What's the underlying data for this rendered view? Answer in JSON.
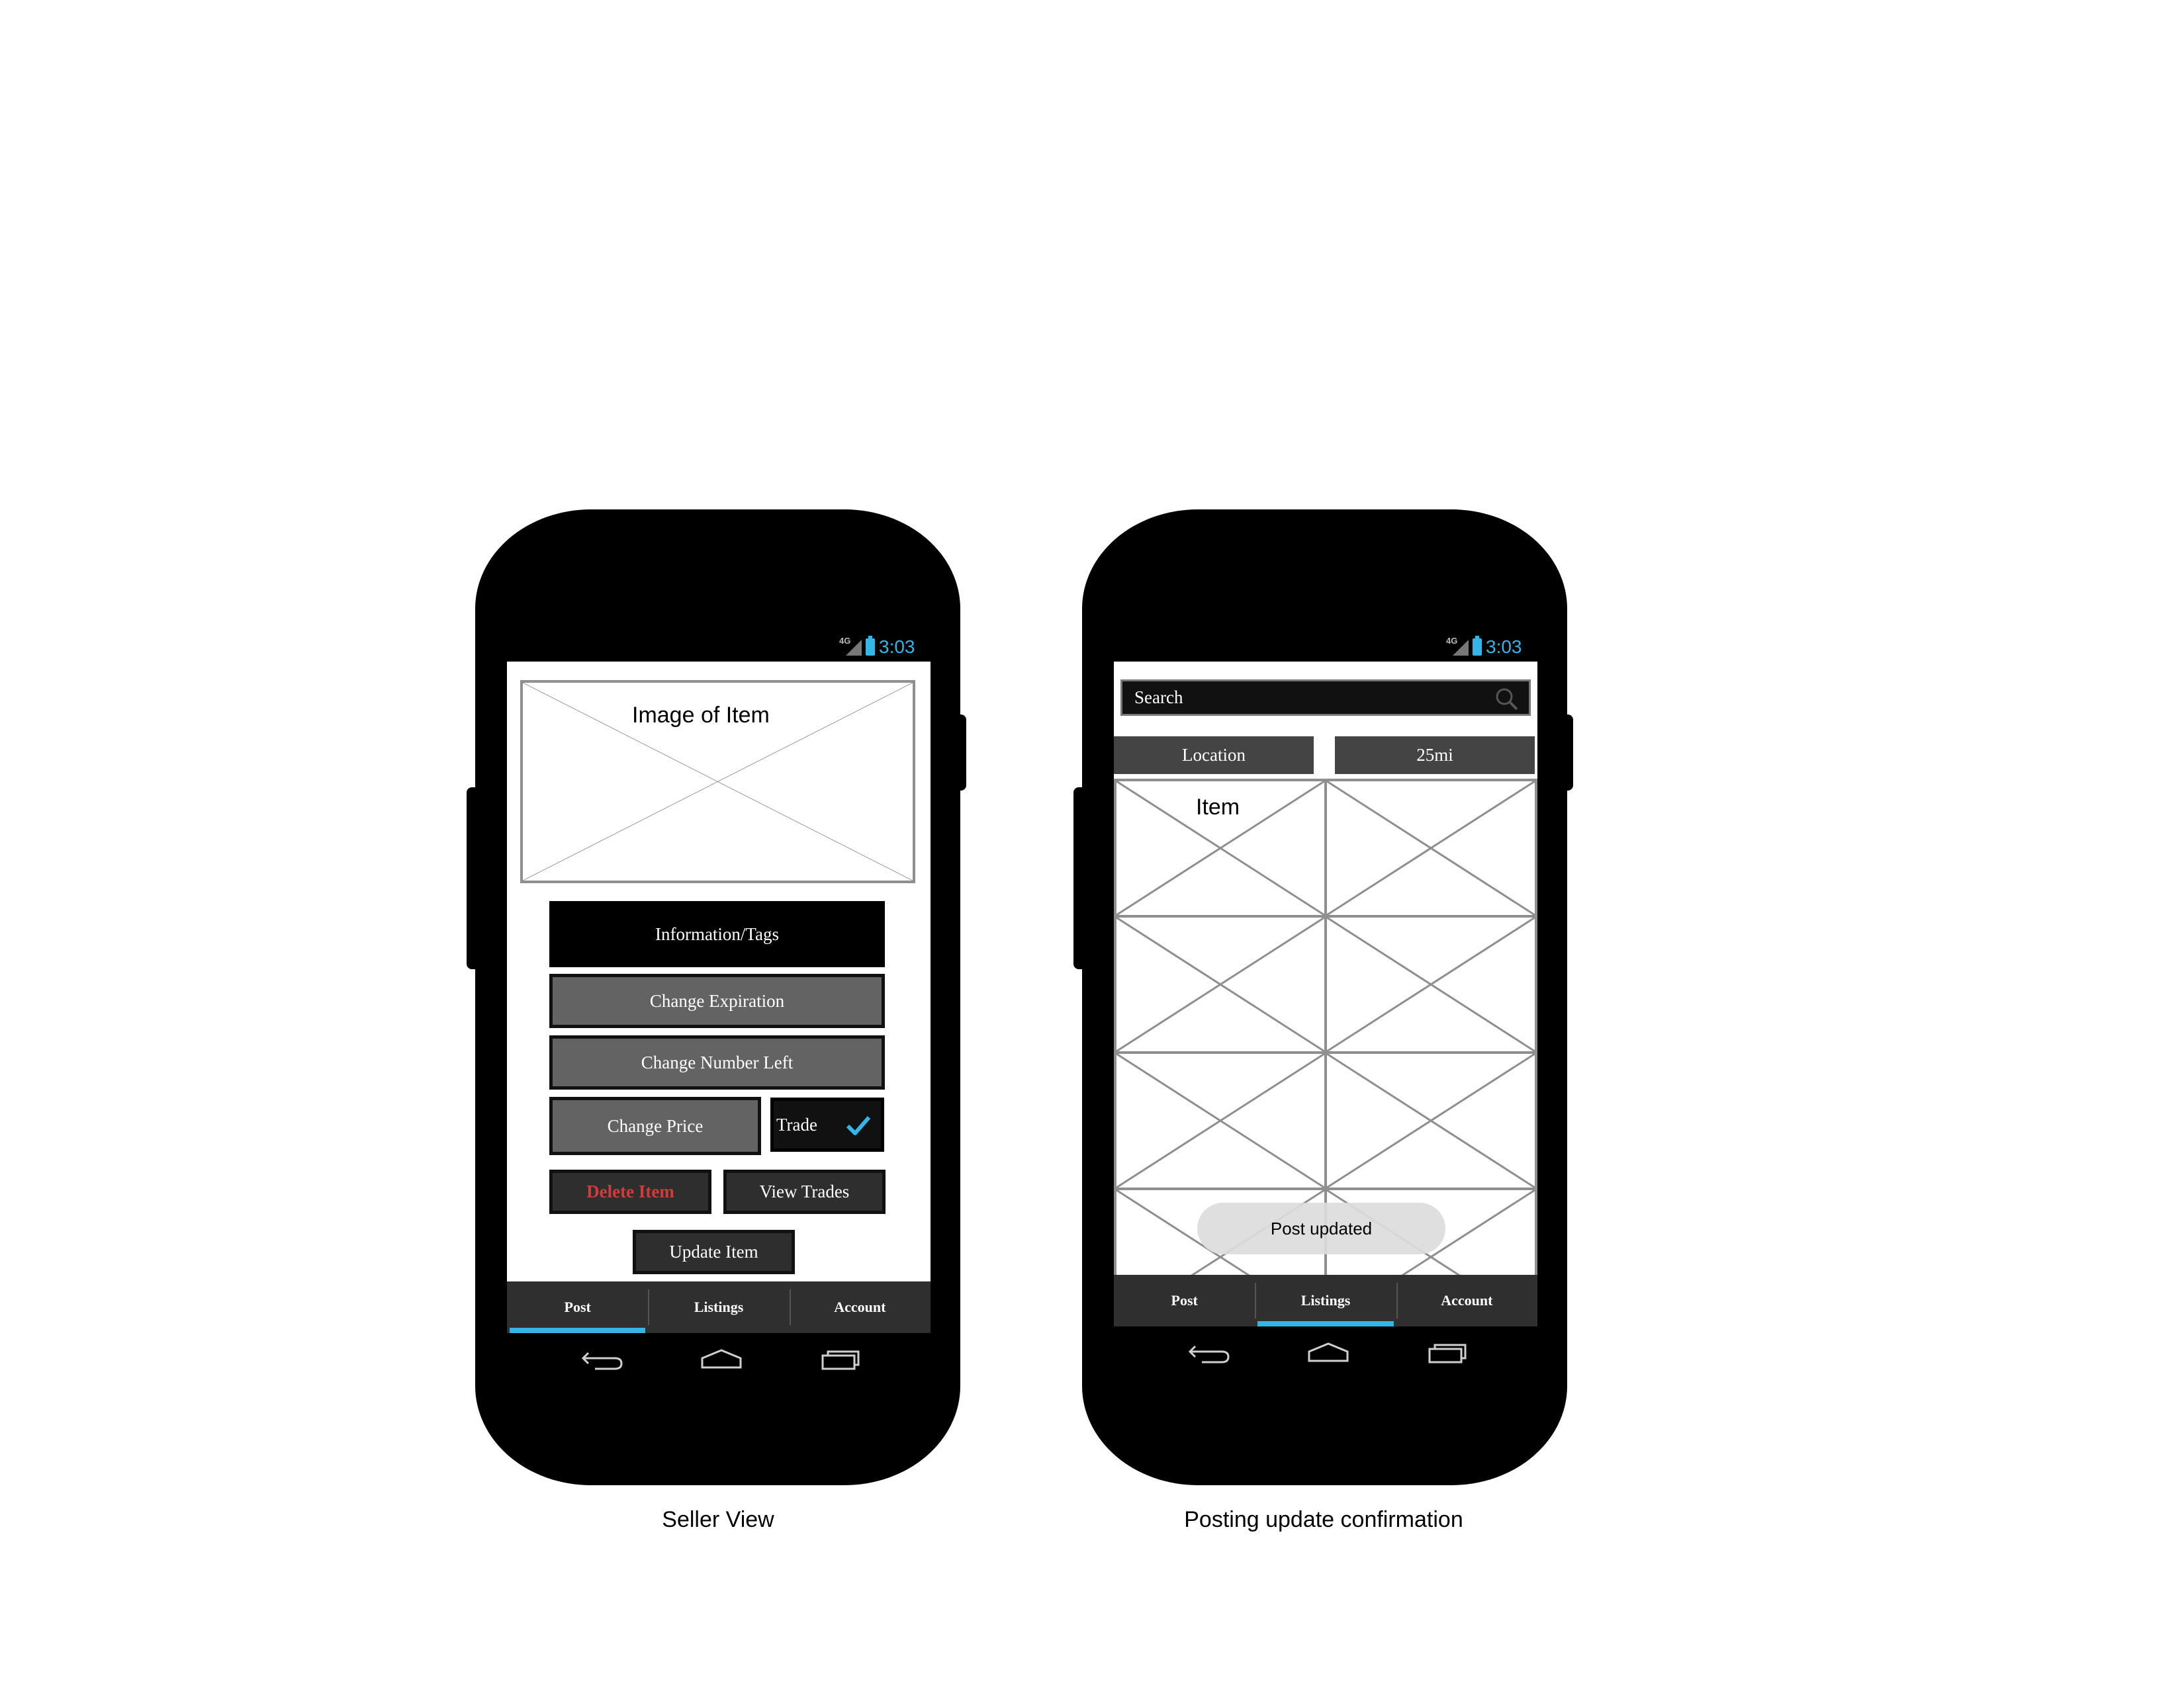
{
  "status_bar": {
    "network": "4G",
    "time": "3:03"
  },
  "seller_view": {
    "image_placeholder_label": "Image of Item",
    "info_button": "Information/Tags",
    "change_expiration": "Change Expiration",
    "change_number_left": "Change Number Left",
    "change_price": "Change Price",
    "trade_label": "Trade",
    "trade_checked": true,
    "delete_item": "Delete Item",
    "view_trades": "View Trades",
    "update_item": "Update Item",
    "caption": "Seller View"
  },
  "confirmation_view": {
    "search_placeholder": "Search",
    "location_button": "Location",
    "distance_button": "25mi",
    "first_item_label": "Item",
    "toast": "Post updated",
    "caption": "Posting update confirmation"
  },
  "tabs": [
    {
      "label": "Post"
    },
    {
      "label": "Listings"
    },
    {
      "label": "Account"
    }
  ],
  "active_tab": {
    "seller_view": "Post",
    "confirmation_view": "Listings"
  },
  "colors": {
    "accent": "#33b5e5",
    "delete_text": "#d23b3b",
    "tab_bar": "#2f2f2f"
  }
}
